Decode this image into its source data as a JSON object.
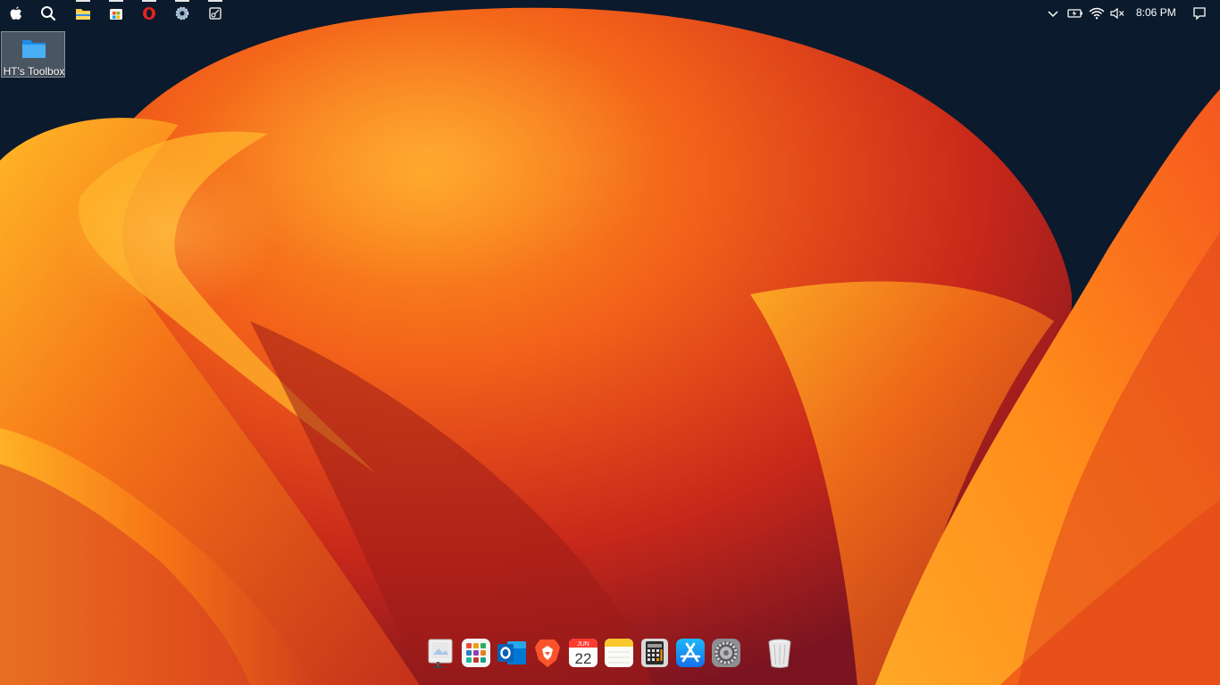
{
  "menubar": {
    "left_icons": [
      {
        "name": "apple-icon"
      },
      {
        "name": "search-icon"
      },
      {
        "name": "file-explorer-icon"
      },
      {
        "name": "store-icon"
      },
      {
        "name": "opera-icon"
      },
      {
        "name": "settings-gear-icon"
      },
      {
        "name": "snipping-tool-icon"
      }
    ],
    "tray": {
      "time": "8:06 PM",
      "icons": [
        "chevron-up-icon",
        "battery-icon",
        "wifi-icon",
        "speaker-muted-icon",
        "notification-icon"
      ]
    }
  },
  "desktop": {
    "icons": [
      {
        "label": "HT's Toolbox",
        "icon": "folder-icon"
      }
    ]
  },
  "dock": {
    "items": [
      {
        "name": "preview-icon"
      },
      {
        "name": "launchpad-icon"
      },
      {
        "name": "outlook-icon"
      },
      {
        "name": "brave-icon"
      },
      {
        "name": "calendar-icon",
        "month": "JUN",
        "day": "22"
      },
      {
        "name": "notes-icon"
      },
      {
        "name": "calculator-icon"
      },
      {
        "name": "app-store-icon"
      },
      {
        "name": "system-preferences-icon"
      },
      {
        "name": "trash-icon"
      }
    ]
  },
  "colors": {
    "background": "#0c1a2c",
    "wallpaper_orange": "#f05a14",
    "wallpaper_yellow": "#ffb020",
    "wallpaper_red": "#b81c10"
  }
}
